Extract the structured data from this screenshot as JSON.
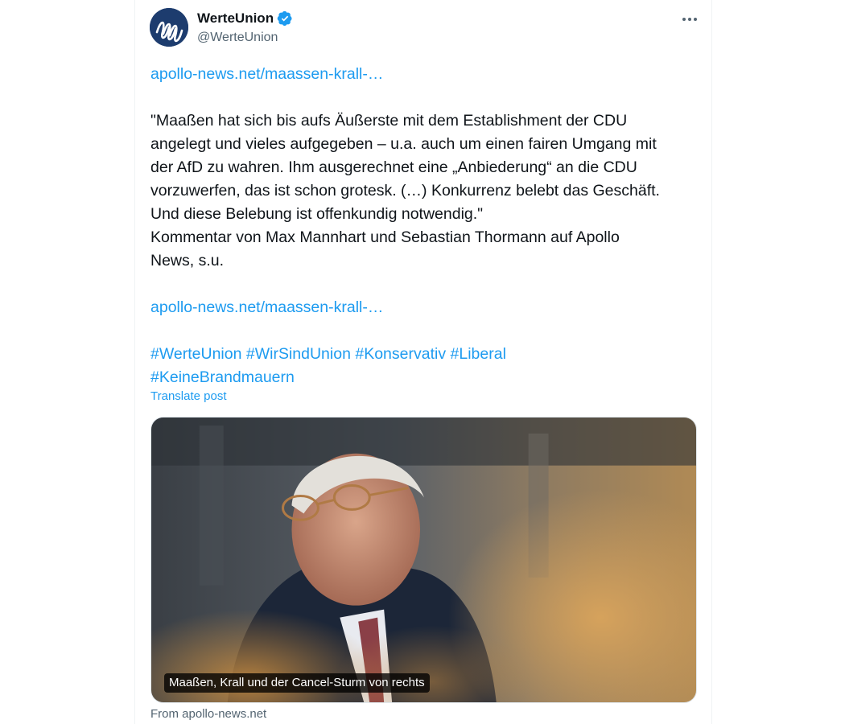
{
  "author": {
    "display_name": "WerteUnion",
    "handle": "@WerteUnion",
    "verified": true
  },
  "post": {
    "link_top": "apollo-news.net/maassen-krall-…",
    "quote_lines": [
      "\"Maaßen hat sich bis aufs Äußerste mit dem Establishment der CDU",
      "angelegt und vieles aufgegeben – u.a. auch um einen fairen Umgang mit",
      "der AfD zu wahren. Ihm ausgerechnet eine „Anbiederung“ an die CDU",
      "vorzuwerfen, das ist schon grotesk. (…) Konkurrenz belebt das Geschäft.",
      "Und diese Belebung ist offenkundig notwendig.\"",
      "Kommentar von Max Mannhart und Sebastian Thormann auf Apollo",
      "News, s.u."
    ],
    "link_bottom": "apollo-news.net/maassen-krall-…",
    "hashtags_line1": [
      "#WerteUnion",
      "#WirSindUnion",
      "#Konservativ",
      "#Liberal"
    ],
    "hashtags_line2": [
      "#KeineBrandmauern"
    ],
    "translate_label": "Translate post"
  },
  "card": {
    "caption": "Maaßen, Krall und der Cancel-Sturm von rechts",
    "source": "From apollo-news.net"
  },
  "colors": {
    "link": "#1d9bf0",
    "text": "#0f1419",
    "secondary": "#536471",
    "verified": "#1d9bf0",
    "avatar_bg": "#1d3c6e"
  }
}
